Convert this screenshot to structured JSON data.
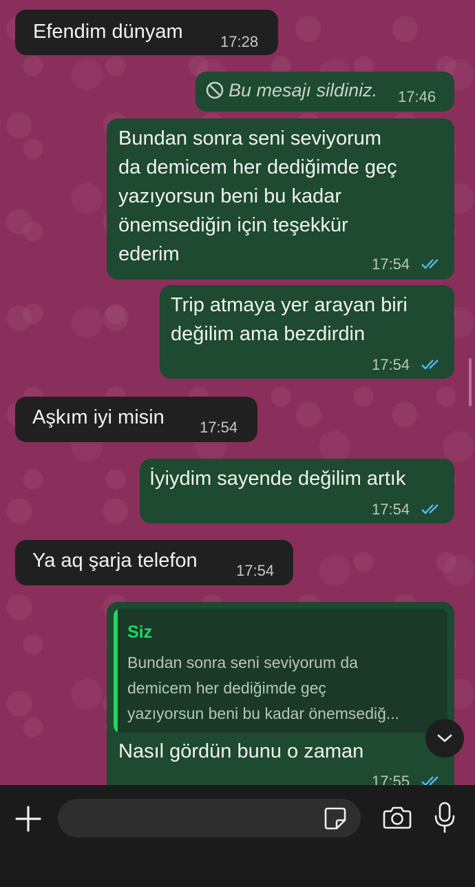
{
  "chat": {
    "messages": [
      {
        "direction": "in",
        "text": "Efendim dünyam",
        "time": "17:28"
      },
      {
        "direction": "out",
        "deleted": true,
        "text": "Bu mesajı sildiniz.",
        "time": "17:46"
      },
      {
        "direction": "out",
        "text": "Bundan sonra seni seviyorum\nda demicem her dediğimde geç\nyazıyorsun beni bu kadar\nönemsediğin için teşekkür\nederim",
        "time": "17:54",
        "status": "read"
      },
      {
        "direction": "out",
        "text": "Trip atmaya yer arayan biri\ndeğilim ama bezdirdin",
        "time": "17:54",
        "status": "read"
      },
      {
        "direction": "in",
        "text": "Aşkım iyi misin",
        "time": "17:54"
      },
      {
        "direction": "out",
        "text": "İyiydim sayende değilim artık",
        "time": "17:54",
        "status": "read"
      },
      {
        "direction": "in",
        "text": "Ya aq şarja telefon",
        "time": "17:54"
      },
      {
        "direction": "out",
        "text": "Nasıl gördün bunu o zaman",
        "time": "17:55",
        "status": "read",
        "quote": {
          "author": "Siz",
          "text": "Bundan sonra seni seviyorum da\ndemicem her dediğimde geç\nyazıyorsun beni bu kadar önemsediğ..."
        }
      }
    ]
  },
  "composer": {
    "placeholder": ""
  },
  "icons": {
    "plus": "plus-icon",
    "sticker": "sticker-icon",
    "camera": "camera-icon",
    "mic": "microphone-icon",
    "scroll_down": "chevron-down-icon",
    "deleted": "prohibited-icon",
    "read": "double-check-icon"
  },
  "colors": {
    "wallpaper": "#8a2f5c",
    "incoming_bubble": "#202020",
    "outgoing_bubble": "#1d4a30",
    "read_ticks": "#53bdeb",
    "quote_author": "#25d366",
    "composer_bar": "#1b1b1b"
  }
}
